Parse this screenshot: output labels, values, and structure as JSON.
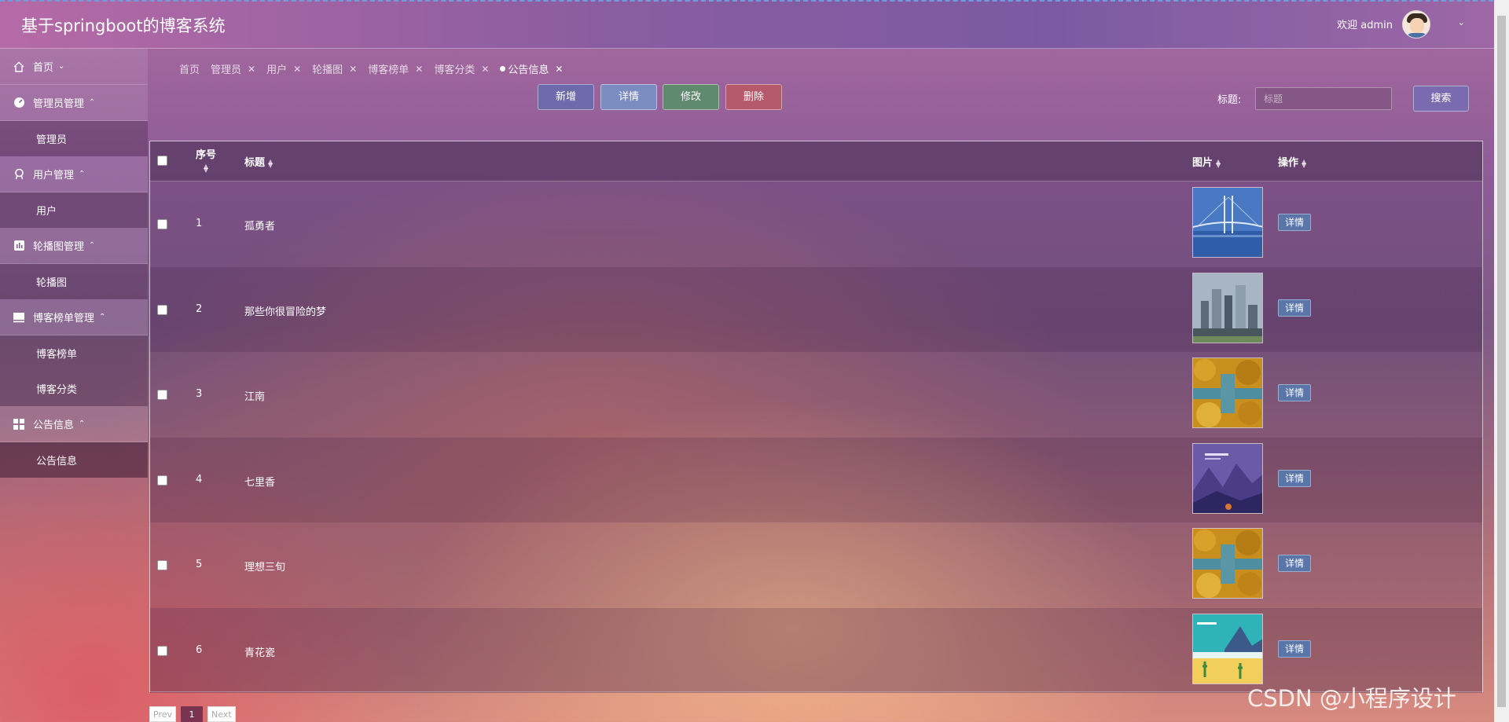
{
  "app": {
    "title": "基于springboot的博客系统",
    "welcome": "欢迎 admin"
  },
  "sidebar": {
    "groups": [
      {
        "label": "首页",
        "icon": "home-icon",
        "items": []
      },
      {
        "label": "管理员管理",
        "icon": "dashboard-icon",
        "items": [
          "管理员"
        ]
      },
      {
        "label": "用户管理",
        "icon": "user-badge-icon",
        "items": [
          "用户"
        ]
      },
      {
        "label": "轮播图管理",
        "icon": "chart-icon",
        "items": [
          "轮播图"
        ]
      },
      {
        "label": "博客榜单管理",
        "icon": "monitor-icon",
        "items": [
          "博客榜单",
          "博客分类"
        ]
      },
      {
        "label": "公告信息",
        "icon": "grid-icon",
        "items": [
          "公告信息"
        ]
      }
    ]
  },
  "tabs": [
    "首页",
    "管理员",
    "用户",
    "轮播图",
    "博客榜单",
    "博客分类",
    "公告信息"
  ],
  "toolbar": {
    "add": "新增",
    "detail": "详情",
    "edit": "修改",
    "delete": "删除"
  },
  "search": {
    "label": "标题:",
    "placeholder": "标题",
    "button": "搜索"
  },
  "table": {
    "headers": {
      "index": "序号",
      "title": "标题",
      "image": "图片",
      "action": "操作"
    },
    "rows": [
      {
        "index": "1",
        "title": "孤勇者",
        "action": "详情",
        "thumb": "bridge"
      },
      {
        "index": "2",
        "title": "那些你很冒险的梦",
        "action": "详情",
        "thumb": "city"
      },
      {
        "index": "3",
        "title": "江南",
        "action": "详情",
        "thumb": "forest"
      },
      {
        "index": "4",
        "title": "七里香",
        "action": "详情",
        "thumb": "mountain"
      },
      {
        "index": "5",
        "title": "理想三旬",
        "action": "详情",
        "thumb": "forest"
      },
      {
        "index": "6",
        "title": "青花瓷",
        "action": "详情",
        "thumb": "desert"
      }
    ]
  },
  "pager": {
    "prev": "Prev",
    "current": "1",
    "next": "Next"
  },
  "watermark": "CSDN @小程序设计"
}
